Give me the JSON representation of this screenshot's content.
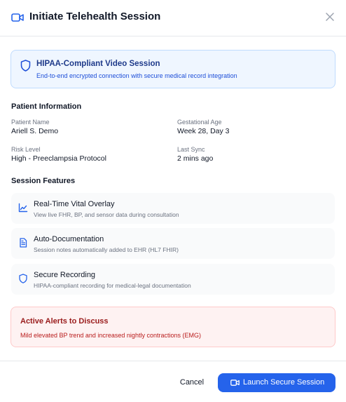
{
  "header": {
    "title": "Initiate Telehealth Session",
    "title_icon": "video-camera-icon",
    "close_icon": "close-icon"
  },
  "banner": {
    "icon": "shield-icon",
    "title": "HIPAA-Compliant Video Session",
    "subtitle": "End-to-end encrypted connection with secure medical record integration"
  },
  "patient_info": {
    "heading": "Patient Information",
    "fields": [
      {
        "label": "Patient Name",
        "value": "Ariell S. Demo"
      },
      {
        "label": "Gestational Age",
        "value": "Week 28, Day 3"
      },
      {
        "label": "Risk Level",
        "value": "High - Preeclampsia Protocol"
      },
      {
        "label": "Last Sync",
        "value": "2 mins ago"
      }
    ]
  },
  "session_features": {
    "heading": "Session Features",
    "items": [
      {
        "icon": "line-chart-icon",
        "title": "Real-Time Vital Overlay",
        "subtitle": "View live FHR, BP, and sensor data during consultation"
      },
      {
        "icon": "document-icon",
        "title": "Auto-Documentation",
        "subtitle": "Session notes automatically added to EHR (HL7 FHIR)"
      },
      {
        "icon": "shield-icon",
        "title": "Secure Recording",
        "subtitle": "HIPAA-compliant recording for medical-legal documentation"
      }
    ]
  },
  "alerts": {
    "title": "Active Alerts to Discuss",
    "body": "Mild elevated BP trend and increased nightly contractions (EMG)"
  },
  "footer": {
    "cancel_label": "Cancel",
    "launch_label": "Launch Secure Session",
    "launch_icon": "video-camera-icon"
  },
  "colors": {
    "accent": "#2563eb",
    "banner_bg": "#eff6ff",
    "alert_bg": "#fef2f2",
    "alert_text": "#991b1b"
  }
}
